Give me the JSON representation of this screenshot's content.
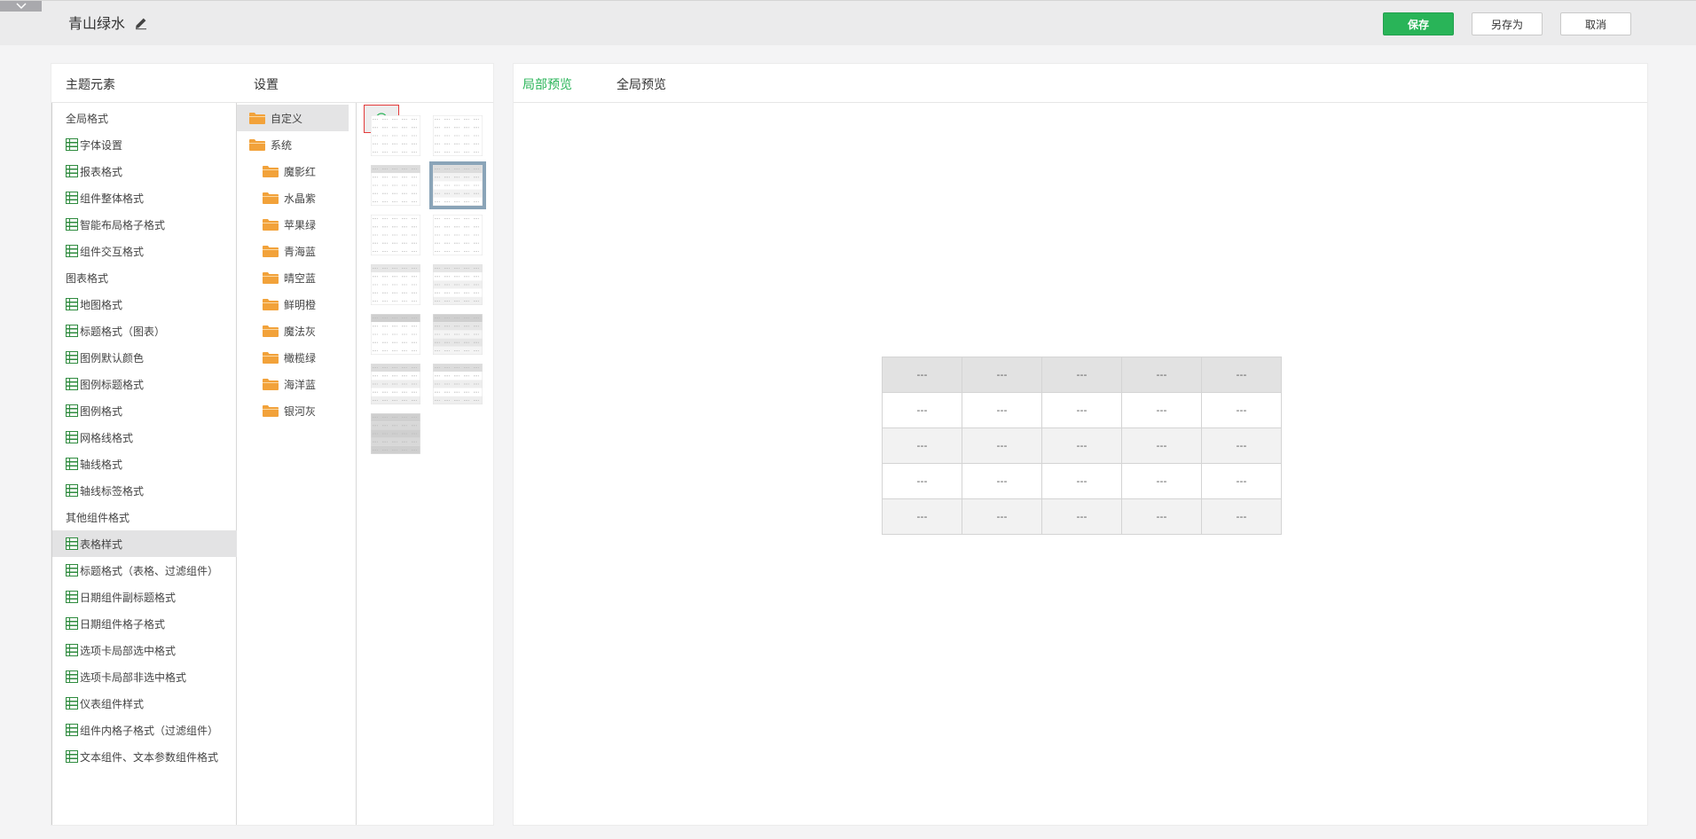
{
  "header": {
    "title": "青山绿水",
    "save_label": "保存",
    "save_as_label": "另存为",
    "cancel_label": "取消"
  },
  "left_panel": {
    "elements_heading": "主题元素",
    "settings_heading": "设置",
    "elements": [
      {
        "label": "全局格式",
        "kind": "group"
      },
      {
        "label": "字体设置",
        "kind": "leaf"
      },
      {
        "label": "报表格式",
        "kind": "leaf"
      },
      {
        "label": "组件整体格式",
        "kind": "leaf"
      },
      {
        "label": "智能布局格子格式",
        "kind": "leaf"
      },
      {
        "label": "组件交互格式",
        "kind": "leaf"
      },
      {
        "label": "图表格式",
        "kind": "group"
      },
      {
        "label": "地图格式",
        "kind": "leaf"
      },
      {
        "label": "标题格式（图表）",
        "kind": "leaf"
      },
      {
        "label": "图例默认颜色",
        "kind": "leaf"
      },
      {
        "label": "图例标题格式",
        "kind": "leaf"
      },
      {
        "label": "图例格式",
        "kind": "leaf"
      },
      {
        "label": "网格线格式",
        "kind": "leaf"
      },
      {
        "label": "轴线格式",
        "kind": "leaf"
      },
      {
        "label": "轴线标签格式",
        "kind": "leaf"
      },
      {
        "label": "其他组件格式",
        "kind": "group"
      },
      {
        "label": "表格样式",
        "kind": "leaf",
        "active": true
      },
      {
        "label": "标题格式（表格、过滤组件）",
        "kind": "leaf"
      },
      {
        "label": "日期组件副标题格式",
        "kind": "leaf"
      },
      {
        "label": "日期组件格子格式",
        "kind": "leaf"
      },
      {
        "label": "选项卡局部选中格式",
        "kind": "leaf"
      },
      {
        "label": "选项卡局部非选中格式",
        "kind": "leaf"
      },
      {
        "label": "仪表组件样式",
        "kind": "leaf"
      },
      {
        "label": "组件内格子格式（过滤组件）",
        "kind": "leaf"
      },
      {
        "label": "文本组件、文本参数组件格式",
        "kind": "leaf"
      }
    ],
    "folders": {
      "custom": "自定义",
      "system": "系统",
      "system_children": [
        "魔影红",
        "水晶紫",
        "苹果绿",
        "青海蓝",
        "晴空蓝",
        "鲜明橙",
        "魔法灰",
        "橄榄绿",
        "海洋蓝",
        "银河灰"
      ]
    }
  },
  "right_panel": {
    "tab_local": "局部预览",
    "tab_global": "全局预览",
    "preview_rows": [
      [
        "---",
        "---",
        "---",
        "---",
        "---"
      ],
      [
        "---",
        "---",
        "---",
        "---",
        "---"
      ],
      [
        "---",
        "---",
        "---",
        "---",
        "---"
      ],
      [
        "---",
        "---",
        "---",
        "---",
        "---"
      ],
      [
        "---",
        "---",
        "---",
        "---",
        "---"
      ]
    ]
  },
  "colors": {
    "accent_green": "#29b458",
    "folder_orange": "#f2a23a",
    "icon_green": "#2e8b3e",
    "highlight_red": "#e33a3a",
    "selected_thumb": "#8aa4b8"
  },
  "icons": {
    "collapse": "chevron-down-icon",
    "edit": "pencil-icon",
    "add": "plus-circle-icon",
    "element": "grid-icon",
    "folder": "folder-icon"
  }
}
